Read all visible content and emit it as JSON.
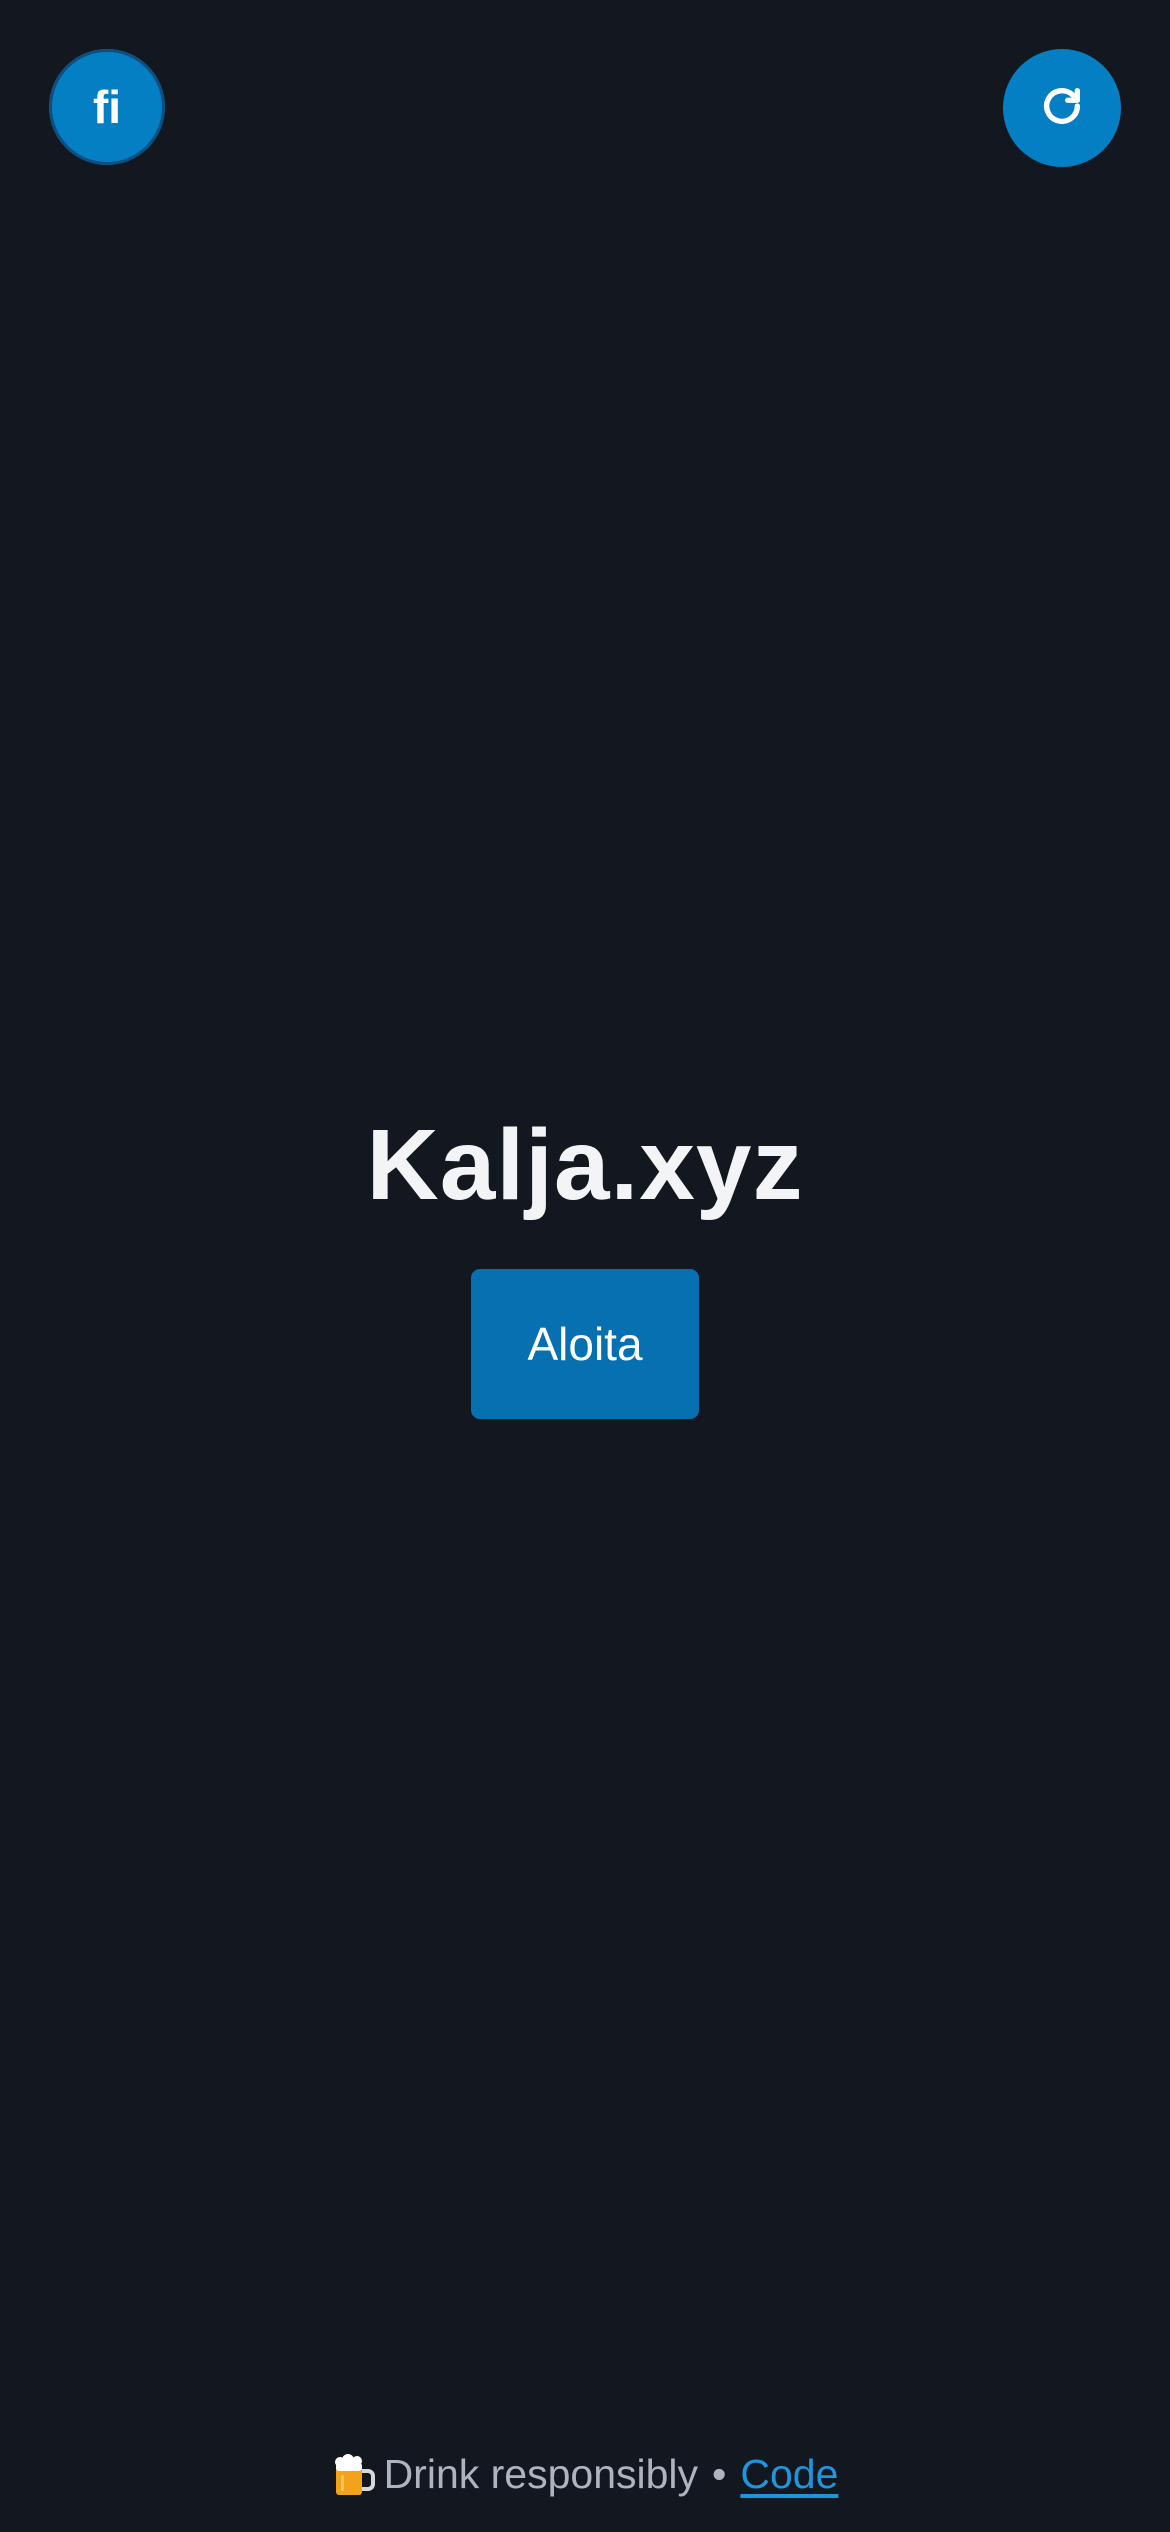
{
  "header": {
    "language_label": "fi",
    "refresh_icon": "refresh-icon"
  },
  "main": {
    "title": "Kalja.xyz",
    "start_label": "Aloita"
  },
  "footer": {
    "beer_icon": "beer-mug-icon",
    "drink_text": "Drink responsibly",
    "separator": "•",
    "code_link": "Code"
  },
  "colors": {
    "background": "#131720",
    "accent": "#047fc3",
    "button": "#0670b1",
    "link": "#1f95dc",
    "title_text": "#f3f4f6"
  }
}
